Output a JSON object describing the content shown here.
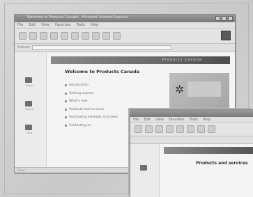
{
  "window1": {
    "title": "Welcome to Products Canada - Microsoft Internet Explorer",
    "menu": [
      "File",
      "Edit",
      "View",
      "Favorites",
      "Tools",
      "Help"
    ],
    "address_label": "Address",
    "address_value": "",
    "banner_text": "Products Canada",
    "heading": "Welcome to Products Canada",
    "links": [
      "Introduction",
      "Getting started",
      "What's new",
      "Products and services",
      "Purchasing methods and sales",
      "Contacting us"
    ],
    "sidebar_labels": [
      "Home",
      "Search",
      "Help"
    ],
    "status": "Done"
  },
  "window2": {
    "menu": [
      "File",
      "Edit",
      "View",
      "Favorites",
      "Tools",
      "Help"
    ],
    "heading": "Products and services"
  },
  "icons": {
    "promo": "gear-wrench-icon",
    "throbber": "browser-logo-icon"
  }
}
